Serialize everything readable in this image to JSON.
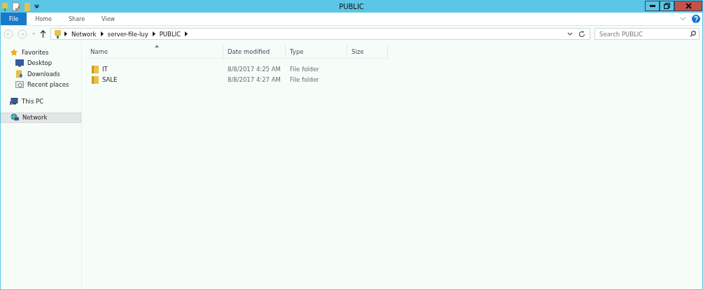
{
  "window": {
    "title": "PUBLIC"
  },
  "ribbon": {
    "tabs": [
      {
        "label": "File",
        "selected": true
      },
      {
        "label": "Home",
        "selected": false
      },
      {
        "label": "Share",
        "selected": false
      },
      {
        "label": "View",
        "selected": false
      }
    ]
  },
  "address_bar": {
    "crumbs": [
      "Network",
      "server-file-luy",
      "PUBLIC"
    ]
  },
  "search": {
    "placeholder": "Search PUBLIC"
  },
  "sidebar": {
    "items": [
      {
        "label": "Favorites",
        "selected": false,
        "children": [
          {
            "label": "Desktop",
            "selected": false
          },
          {
            "label": "Downloads",
            "selected": false
          },
          {
            "label": "Recent places",
            "selected": false
          }
        ]
      },
      {
        "label": "This PC",
        "selected": false
      },
      {
        "label": "Network",
        "selected": true
      }
    ]
  },
  "table": {
    "columns": [
      {
        "label": "Name",
        "sorted": true
      },
      {
        "label": "Date modified",
        "sorted": false
      },
      {
        "label": "Type",
        "sorted": false
      },
      {
        "label": "Size",
        "sorted": false
      }
    ],
    "rows": [
      {
        "name": "IT",
        "date": "8/8/2017 4:25 AM",
        "type": "File folder",
        "selected": false
      },
      {
        "name": "SALE",
        "date": "8/8/2017 4:27 AM",
        "type": "File folder",
        "selected": false
      }
    ]
  }
}
